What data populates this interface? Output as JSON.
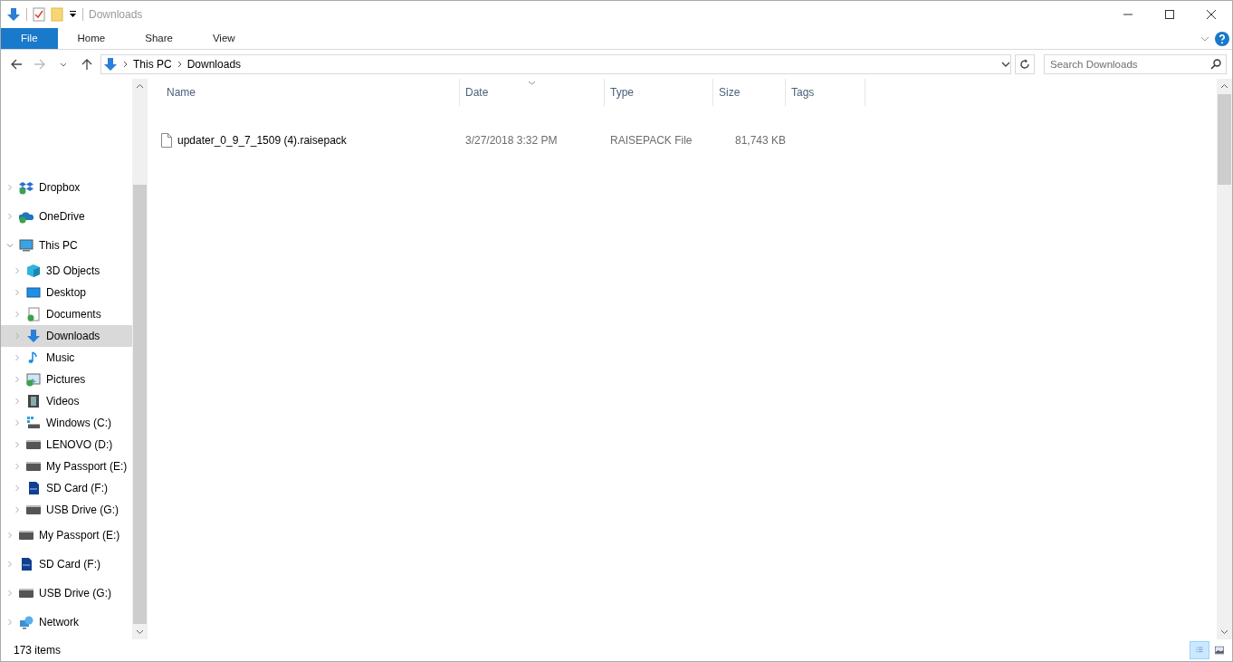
{
  "window": {
    "title": "Downloads"
  },
  "ribbon_tabs": [
    {
      "label": "File",
      "selected": true
    },
    {
      "label": "Home",
      "selected": false
    },
    {
      "label": "Share",
      "selected": false
    },
    {
      "label": "View",
      "selected": false
    }
  ],
  "address": {
    "path": [
      "This PC",
      "Downloads"
    ]
  },
  "search": {
    "placeholder": "Search Downloads"
  },
  "sidebar": {
    "items": [
      {
        "label": "Dropbox",
        "kind": "dropbox",
        "expanded": false,
        "selected": false
      },
      {
        "label": "OneDrive",
        "kind": "onedrive",
        "expanded": false,
        "selected": false
      },
      {
        "label": "This PC",
        "kind": "pc",
        "expanded": true,
        "selected": false,
        "children": [
          {
            "label": "3D Objects",
            "kind": "cube",
            "expanded": false,
            "selected": false
          },
          {
            "label": "Desktop",
            "kind": "desktop",
            "expanded": false,
            "selected": false
          },
          {
            "label": "Documents",
            "kind": "documents",
            "expanded": false,
            "selected": false
          },
          {
            "label": "Downloads",
            "kind": "download",
            "expanded": false,
            "selected": true
          },
          {
            "label": "Music",
            "kind": "music",
            "expanded": false,
            "selected": false
          },
          {
            "label": "Pictures",
            "kind": "pictures",
            "expanded": false,
            "selected": false
          },
          {
            "label": "Videos",
            "kind": "videos",
            "expanded": false,
            "selected": false
          },
          {
            "label": "Windows (C:)",
            "kind": "windrive",
            "expanded": false,
            "selected": false
          },
          {
            "label": "LENOVO (D:)",
            "kind": "drive",
            "expanded": false,
            "selected": false
          },
          {
            "label": "My Passport (E:)",
            "kind": "drive",
            "expanded": false,
            "selected": false
          },
          {
            "label": "SD Card (F:)",
            "kind": "sdcard",
            "expanded": false,
            "selected": false
          },
          {
            "label": "USB Drive (G:)",
            "kind": "drive",
            "expanded": false,
            "selected": false
          }
        ]
      },
      {
        "label": "My Passport (E:)",
        "kind": "drive",
        "expanded": false,
        "selected": false
      },
      {
        "label": "SD Card (F:)",
        "kind": "sdcard",
        "expanded": false,
        "selected": false
      },
      {
        "label": "USB Drive (G:)",
        "kind": "drive",
        "expanded": false,
        "selected": false
      },
      {
        "label": "Network",
        "kind": "network",
        "expanded": false,
        "selected": false
      }
    ]
  },
  "table": {
    "columns": [
      {
        "label": "Name",
        "sorted": false
      },
      {
        "label": "Date",
        "sorted": true
      },
      {
        "label": "Type",
        "sorted": false
      },
      {
        "label": "Size",
        "sorted": false
      },
      {
        "label": "Tags",
        "sorted": false
      }
    ],
    "rows": [
      {
        "name": "updater_0_9_7_1509 (4).raisepack",
        "date": "3/27/2018 3:32 PM",
        "type": "RAISEPACK File",
        "size": "81,743 KB"
      }
    ]
  },
  "status_bar": {
    "count": "173 items"
  }
}
